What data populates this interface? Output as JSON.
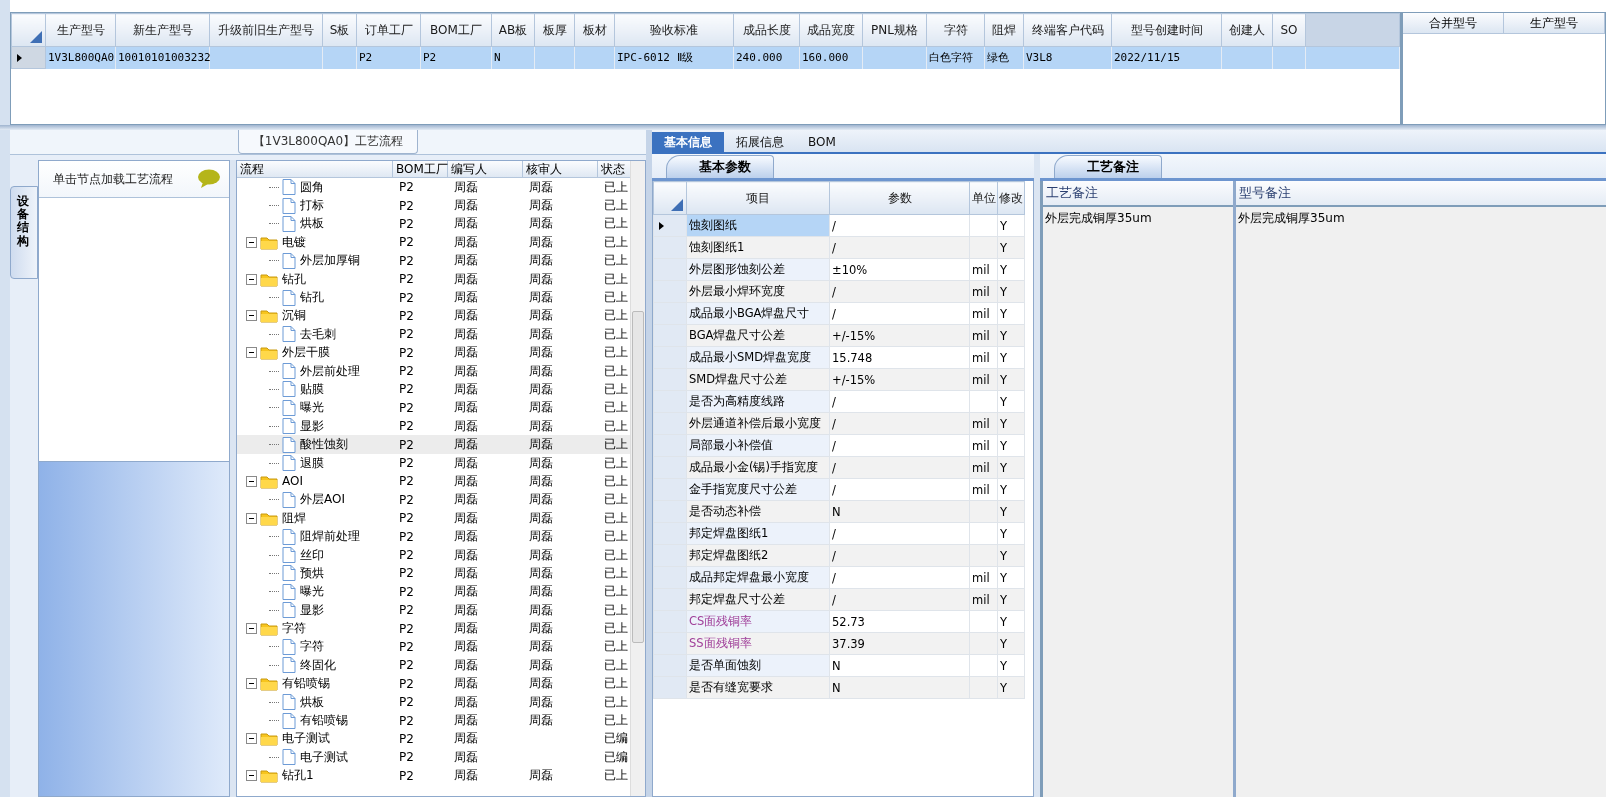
{
  "top_grid": {
    "columns": [
      "生产型号",
      "新生产型号",
      "升级前旧生产型号",
      "S板",
      "订单工厂",
      "BOM工厂",
      "AB板",
      "板厚",
      "板材",
      "验收标准",
      "成品长度",
      "成品宽度",
      "PNL规格",
      "字符",
      "阻焊",
      "终端客户代码",
      "型号创建时间",
      "创建人",
      "SO"
    ],
    "rows": [
      {
        "selected": true,
        "cells": [
          "1V3L800QA0",
          "10010101003232",
          null,
          null,
          "P2",
          "P2",
          "N",
          null,
          null,
          "IPC-6012 Ⅱ级",
          "240.000",
          "160.000",
          null,
          "白色字符",
          "绿色",
          "V3L8",
          "2022/11/15",
          null,
          null
        ]
      }
    ]
  },
  "merge_grid": {
    "columns": [
      "合并型号",
      "生产型号"
    ]
  },
  "flow_panel": {
    "title": "【1V3L800QA0】工艺流程",
    "side_tab": "设备结构",
    "side_header": "单击节点加载工艺流程",
    "columns": [
      "流程",
      "BOM工厂",
      "编写人",
      "核审人",
      "状态"
    ],
    "tree": [
      {
        "children": [
          {
            "kind": "step",
            "label": "圆角",
            "bom": "P2",
            "writer": "周磊",
            "reviewer": "周磊",
            "status": "已上",
            "selected": false
          },
          {
            "kind": "step",
            "label": "打标",
            "bom": "P2",
            "writer": "周磊",
            "reviewer": "周磊",
            "status": "已上",
            "selected": false
          },
          {
            "kind": "step",
            "label": "烘板",
            "bom": "P2",
            "writer": "周磊",
            "reviewer": "周磊",
            "status": "已上",
            "selected": false
          }
        ]
      },
      {
        "kind": "folder",
        "label": "电镀",
        "bom": "P2",
        "writer": "周磊",
        "reviewer": "周磊",
        "status": "已上",
        "selected": false,
        "expanded": true,
        "children": [
          {
            "kind": "step",
            "label": "外层加厚铜",
            "bom": "P2",
            "writer": "周磊",
            "reviewer": "周磊",
            "status": "已上",
            "selected": false
          }
        ]
      },
      {
        "kind": "folder",
        "label": "钻孔",
        "bom": "P2",
        "writer": "周磊",
        "reviewer": "周磊",
        "status": "已上",
        "selected": false,
        "expanded": true,
        "children": [
          {
            "kind": "step",
            "label": "钻孔",
            "bom": "P2",
            "writer": "周磊",
            "reviewer": "周磊",
            "status": "已上",
            "selected": false
          }
        ]
      },
      {
        "kind": "folder",
        "label": "沉铜",
        "bom": "P2",
        "writer": "周磊",
        "reviewer": "周磊",
        "status": "已上",
        "selected": false,
        "expanded": true,
        "children": [
          {
            "kind": "step",
            "label": "去毛刺",
            "bom": "P2",
            "writer": "周磊",
            "reviewer": "周磊",
            "status": "已上",
            "selected": false
          }
        ]
      },
      {
        "kind": "folder",
        "label": "外层干膜",
        "bom": "P2",
        "writer": "周磊",
        "reviewer": "周磊",
        "status": "已上",
        "selected": false,
        "expanded": true,
        "children": [
          {
            "kind": "step",
            "label": "外层前处理",
            "bom": "P2",
            "writer": "周磊",
            "reviewer": "周磊",
            "status": "已上",
            "selected": false
          },
          {
            "kind": "step",
            "label": "贴膜",
            "bom": "P2",
            "writer": "周磊",
            "reviewer": "周磊",
            "status": "已上",
            "selected": false
          },
          {
            "kind": "step",
            "label": "曝光",
            "bom": "P2",
            "writer": "周磊",
            "reviewer": "周磊",
            "status": "已上",
            "selected": false
          },
          {
            "kind": "step",
            "label": "显影",
            "bom": "P2",
            "writer": "周磊",
            "reviewer": "周磊",
            "status": "已上",
            "selected": false
          },
          {
            "kind": "step",
            "label": "酸性蚀刻",
            "bom": "P2",
            "writer": "周磊",
            "reviewer": "周磊",
            "status": "已上",
            "selected": true
          },
          {
            "kind": "step",
            "label": "退膜",
            "bom": "P2",
            "writer": "周磊",
            "reviewer": "周磊",
            "status": "已上",
            "selected": false
          }
        ]
      },
      {
        "kind": "folder",
        "label": "AOI",
        "bom": "P2",
        "writer": "周磊",
        "reviewer": "周磊",
        "status": "已上",
        "selected": false,
        "expanded": true,
        "children": [
          {
            "kind": "step",
            "label": "外层AOI",
            "bom": "P2",
            "writer": "周磊",
            "reviewer": "周磊",
            "status": "已上",
            "selected": false
          }
        ]
      },
      {
        "kind": "folder",
        "label": "阻焊",
        "bom": "P2",
        "writer": "周磊",
        "reviewer": "周磊",
        "status": "已上",
        "selected": false,
        "expanded": true,
        "children": [
          {
            "kind": "step",
            "label": "阻焊前处理",
            "bom": "P2",
            "writer": "周磊",
            "reviewer": "周磊",
            "status": "已上",
            "selected": false
          },
          {
            "kind": "step",
            "label": "丝印",
            "bom": "P2",
            "writer": "周磊",
            "reviewer": "周磊",
            "status": "已上",
            "selected": false
          },
          {
            "kind": "step",
            "label": "预烘",
            "bom": "P2",
            "writer": "周磊",
            "reviewer": "周磊",
            "status": "已上",
            "selected": false
          },
          {
            "kind": "step",
            "label": "曝光",
            "bom": "P2",
            "writer": "周磊",
            "reviewer": "周磊",
            "status": "已上",
            "selected": false
          },
          {
            "kind": "step",
            "label": "显影",
            "bom": "P2",
            "writer": "周磊",
            "reviewer": "周磊",
            "status": "已上",
            "selected": false
          }
        ]
      },
      {
        "kind": "folder",
        "label": "字符",
        "bom": "P2",
        "writer": "周磊",
        "reviewer": "周磊",
        "status": "已上",
        "selected": false,
        "expanded": true,
        "children": [
          {
            "kind": "step",
            "label": "字符",
            "bom": "P2",
            "writer": "周磊",
            "reviewer": "周磊",
            "status": "已上",
            "selected": false
          },
          {
            "kind": "step",
            "label": "终固化",
            "bom": "P2",
            "writer": "周磊",
            "reviewer": "周磊",
            "status": "已上",
            "selected": false
          }
        ]
      },
      {
        "kind": "folder",
        "label": "有铅喷锡",
        "bom": "P2",
        "writer": "周磊",
        "reviewer": "周磊",
        "status": "已上",
        "selected": false,
        "expanded": true,
        "children": [
          {
            "kind": "step",
            "label": "烘板",
            "bom": "P2",
            "writer": "周磊",
            "reviewer": "周磊",
            "status": "已上",
            "selected": false
          },
          {
            "kind": "step",
            "label": "有铅喷锡",
            "bom": "P2",
            "writer": "周磊",
            "reviewer": "周磊",
            "status": "已上",
            "selected": false
          }
        ]
      },
      {
        "kind": "folder",
        "label": "电子测试",
        "bom": "P2",
        "writer": "周磊",
        "status": "已编",
        "selected": false,
        "expanded": true,
        "children": [
          {
            "kind": "step",
            "label": "电子测试",
            "bom": "P2",
            "writer": "周磊",
            "status": "已编",
            "selected": false
          }
        ]
      },
      {
        "kind": "folder",
        "label": "钻孔1",
        "bom": "P2",
        "writer": "周磊",
        "reviewer": "周磊",
        "status": "已上",
        "selected": false,
        "expanded": true
      }
    ]
  },
  "detail_tabs": [
    {
      "label": "基本信息",
      "selected": true
    },
    {
      "label": "拓展信息",
      "selected": false
    },
    {
      "label": "BOM",
      "selected": false
    }
  ],
  "params": {
    "tab": "基本参数",
    "columns": [
      "项目",
      "参数",
      "单位",
      "修改"
    ],
    "rows": [
      {
        "item": "蚀刻图纸",
        "value": "/",
        "edit": "Y",
        "selected": true
      },
      {
        "item": "蚀刻图纸1",
        "value": "/",
        "edit": "Y",
        "selected": false
      },
      {
        "item": "外层图形蚀刻公差",
        "value": "±10%",
        "unit": "mil",
        "edit": "Y",
        "selected": false
      },
      {
        "item": "外层最小焊环宽度",
        "value": "/",
        "unit": "mil",
        "edit": "Y",
        "selected": false
      },
      {
        "item": "成品最小BGA焊盘尺寸",
        "value": "/",
        "unit": "mil",
        "edit": "Y",
        "selected": false
      },
      {
        "item": "BGA焊盘尺寸公差",
        "value": "+/-15%",
        "unit": "mil",
        "edit": "Y",
        "selected": false
      },
      {
        "item": "成品最小SMD焊盘宽度",
        "value": "15.748",
        "unit": "mil",
        "edit": "Y",
        "selected": false
      },
      {
        "item": "SMD焊盘尺寸公差",
        "value": "+/-15%",
        "unit": "mil",
        "edit": "Y",
        "selected": false
      },
      {
        "item": "是否为高精度线路",
        "value": "/",
        "edit": "Y",
        "selected": false
      },
      {
        "item": "外层通道补偿后最小宽度",
        "value": "/",
        "unit": "mil",
        "edit": "Y",
        "selected": false
      },
      {
        "item": "局部最小补偿值",
        "value": "/",
        "unit": "mil",
        "edit": "Y",
        "selected": false
      },
      {
        "item": "成品最小金(锡)手指宽度",
        "value": "/",
        "unit": "mil",
        "edit": "Y",
        "selected": false
      },
      {
        "item": "金手指宽度尺寸公差",
        "value": "/",
        "unit": "mil",
        "edit": "Y",
        "selected": false
      },
      {
        "item": "是否动态补偿",
        "value": "N",
        "edit": "Y",
        "selected": false
      },
      {
        "item": "邦定焊盘图纸1",
        "value": "/",
        "edit": "Y",
        "selected": false
      },
      {
        "item": "邦定焊盘图纸2",
        "value": "/",
        "edit": "Y",
        "selected": false
      },
      {
        "item": "成品邦定焊盘最小宽度",
        "value": "/",
        "unit": "mil",
        "edit": "Y",
        "selected": false
      },
      {
        "item": "邦定焊盘尺寸公差",
        "value": "/",
        "unit": "mil",
        "edit": "Y",
        "selected": false
      },
      {
        "item": "CS面残铜率",
        "value": "52.73",
        "edit": "Y",
        "color": "#a0409a",
        "selected": false
      },
      {
        "item": "SS面残铜率",
        "value": "37.39",
        "edit": "Y",
        "color": "#a0409a",
        "selected": false
      },
      {
        "item": "是否单面蚀刻",
        "value": "N",
        "edit": "Y",
        "selected": false
      },
      {
        "item": "是否有缝宽要求",
        "value": "N",
        "edit": "Y",
        "selected": false
      }
    ]
  },
  "notes": {
    "tab": "工艺备注",
    "columns": [
      "工艺备注",
      "型号备注"
    ],
    "values": [
      "外层完成铜厚35um",
      "外层完成铜厚35um"
    ]
  }
}
